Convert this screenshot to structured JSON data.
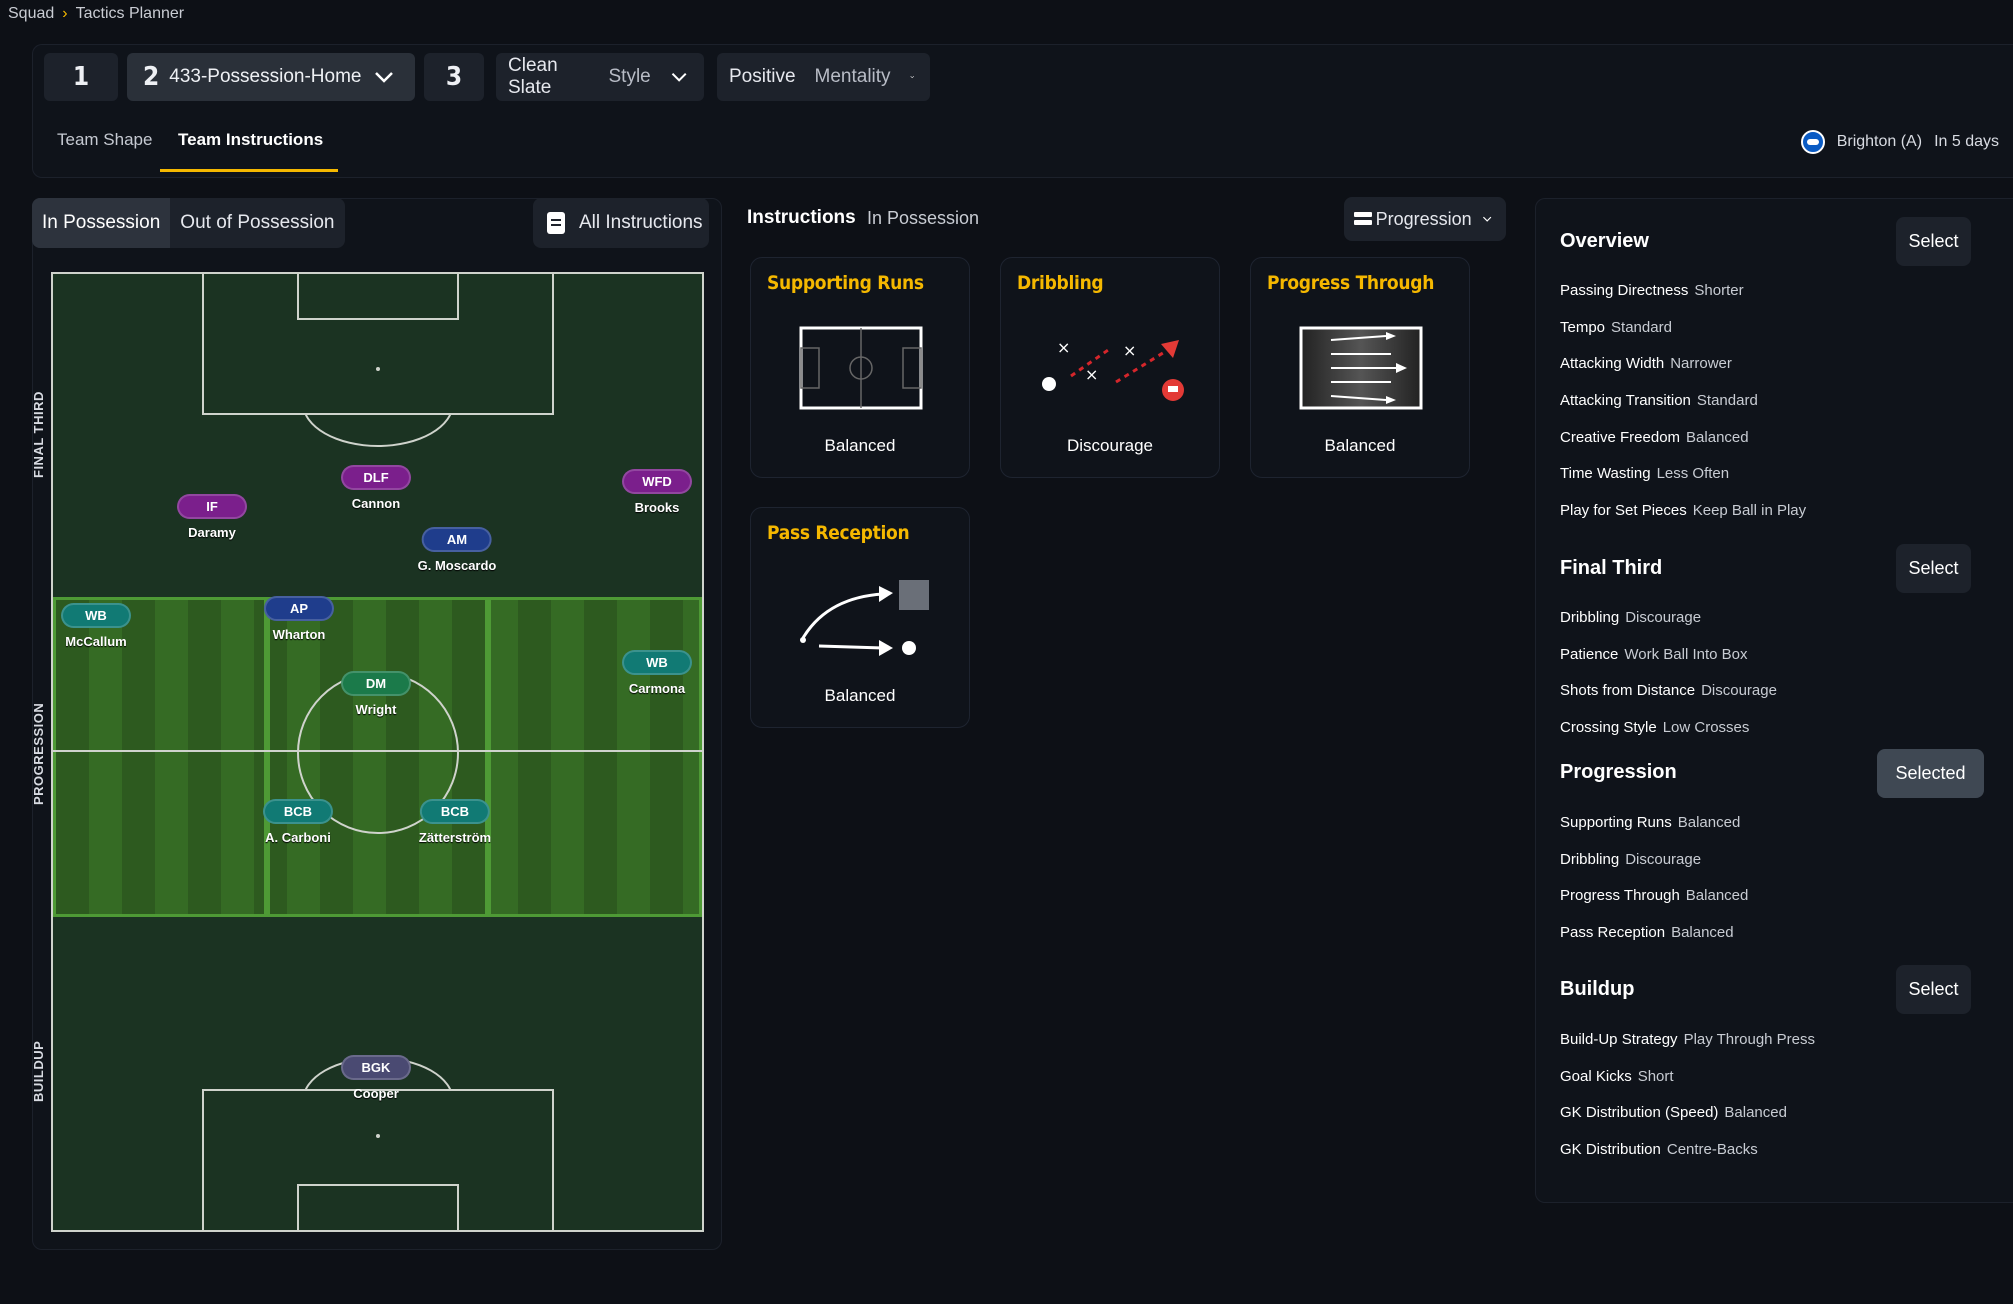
{
  "breadcrumb": {
    "root": "Squad",
    "current": "Tactics Planner"
  },
  "tactics": {
    "slot1": "1",
    "slot2_num": "2",
    "slot2_name": "433-Possession-Home",
    "slot3": "3"
  },
  "style": {
    "value": "Clean Slate",
    "label": "Style"
  },
  "mentality": {
    "value": "Positive",
    "label": "Mentality"
  },
  "tabs": {
    "shape": "Team Shape",
    "instructions": "Team Instructions"
  },
  "fixture": {
    "opponent": "Brighton (A)",
    "when": "In 5 days"
  },
  "phase_toggle": {
    "in_possession": "In Possession",
    "out_of_possession": "Out of Possession"
  },
  "all_instructions": "All Instructions",
  "zones": {
    "final_third": "FINAL THIRD",
    "progression": "PROGRESSION",
    "buildup": "BUILDUP"
  },
  "players": [
    {
      "role": "IF",
      "name": "Daramy"
    },
    {
      "role": "DLF",
      "name": "Cannon"
    },
    {
      "role": "WFD",
      "name": "Brooks"
    },
    {
      "role": "AM",
      "name": "G. Moscardo"
    },
    {
      "role": "WB",
      "name": "McCallum"
    },
    {
      "role": "AP",
      "name": "Wharton"
    },
    {
      "role": "WB",
      "name": "Carmona"
    },
    {
      "role": "DM",
      "name": "Wright"
    },
    {
      "role": "BCB",
      "name": "A. Carboni"
    },
    {
      "role": "BCB",
      "name": "Zätterström"
    },
    {
      "role": "BGK",
      "name": "Cooper"
    }
  ],
  "instructions": {
    "title": "Instructions",
    "subtitle": "In Possession",
    "filter": "Progression",
    "cards": [
      {
        "title": "Supporting Runs",
        "value": "Balanced"
      },
      {
        "title": "Dribbling",
        "value": "Discourage"
      },
      {
        "title": "Progress Through",
        "value": "Balanced"
      },
      {
        "title": "Pass Reception",
        "value": "Balanced"
      }
    ]
  },
  "overview": {
    "title": "Overview",
    "button": "Select",
    "rows": [
      {
        "k": "Passing Directness",
        "v": "Shorter"
      },
      {
        "k": "Tempo",
        "v": "Standard"
      },
      {
        "k": "Attacking Width",
        "v": "Narrower"
      },
      {
        "k": "Attacking Transition",
        "v": "Standard"
      },
      {
        "k": "Creative Freedom",
        "v": "Balanced"
      },
      {
        "k": "Time Wasting",
        "v": "Less Often"
      },
      {
        "k": "Play for Set Pieces",
        "v": "Keep Ball in Play"
      }
    ]
  },
  "final_third": {
    "title": "Final Third",
    "button": "Select",
    "rows": [
      {
        "k": "Dribbling",
        "v": "Discourage"
      },
      {
        "k": "Patience",
        "v": "Work Ball Into Box"
      },
      {
        "k": "Shots from Distance",
        "v": "Discourage"
      },
      {
        "k": "Crossing Style",
        "v": "Low Crosses"
      }
    ]
  },
  "progression": {
    "title": "Progression",
    "button": "Selected",
    "rows": [
      {
        "k": "Supporting Runs",
        "v": "Balanced"
      },
      {
        "k": "Dribbling",
        "v": "Discourage"
      },
      {
        "k": "Progress Through",
        "v": "Balanced"
      },
      {
        "k": "Pass Reception",
        "v": "Balanced"
      }
    ]
  },
  "buildup": {
    "title": "Buildup",
    "button": "Select",
    "rows": [
      {
        "k": "Build-Up Strategy",
        "v": "Play Through Press"
      },
      {
        "k": "Goal Kicks",
        "v": "Short"
      },
      {
        "k": "GK Distribution (Speed)",
        "v": "Balanced"
      },
      {
        "k": "GK Distribution",
        "v": "Centre-Backs"
      }
    ]
  },
  "colors": {
    "accent": "#f5b800",
    "background": "#0d1016",
    "panel": "#1d222b"
  }
}
